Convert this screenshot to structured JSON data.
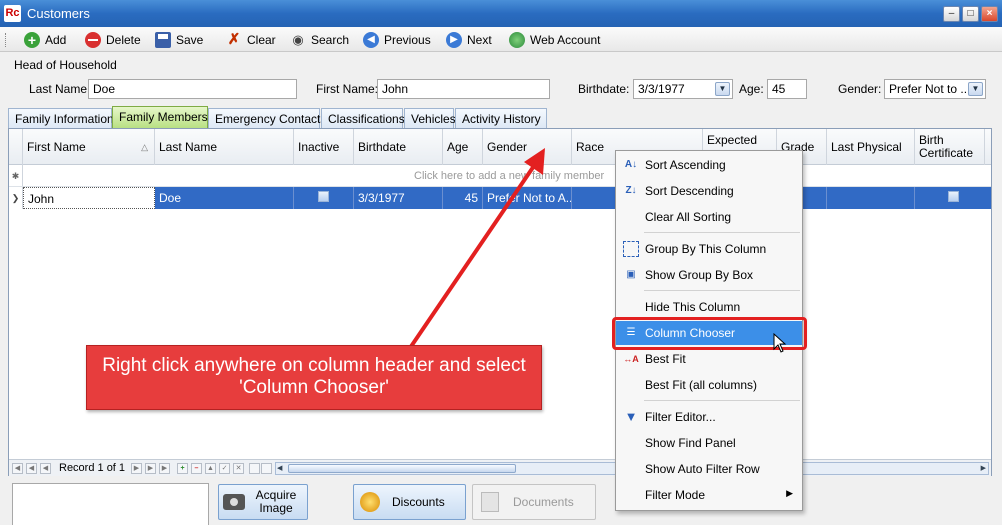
{
  "window": {
    "title": "Customers",
    "app_icon": "Rc"
  },
  "toolbar": {
    "add": "Add",
    "delete": "Delete",
    "save": "Save",
    "clear": "Clear",
    "search": "Search",
    "previous": "Previous",
    "next": "Next",
    "web_account": "Web Account"
  },
  "head_of_household": {
    "section_label": "Head of Household",
    "last_name_label": "Last Name:",
    "last_name": "Doe",
    "first_name_label": "First Name:",
    "first_name": "John",
    "birthdate_label": "Birthdate:",
    "birthdate": "3/3/1977",
    "age_label": "Age:",
    "age": "45",
    "gender_label": "Gender:",
    "gender": "Prefer Not to ..."
  },
  "tabs": [
    "Family Information",
    "Family Members",
    "Emergency Contacts",
    "Classifications",
    "Vehicles",
    "Activity History"
  ],
  "active_tab": "Family Members",
  "grid": {
    "columns": [
      "First Name",
      "Last Name",
      "Inactive",
      "Birthdate",
      "Age",
      "Gender",
      "Race",
      "Expected",
      "Grade",
      "Last Physical",
      "Birth Certificate"
    ],
    "new_row_prompt": "Click here to add a new family member",
    "rows": [
      {
        "first_name": "John",
        "last_name": "Doe",
        "birthdate": "3/3/1977",
        "age": "45",
        "gender": "Prefer Not to A..."
      }
    ]
  },
  "navigator": {
    "record_text": "Record 1 of 1"
  },
  "bottom": {
    "acquire_image": "Acquire Image",
    "discounts": "Discounts",
    "documents": "Documents"
  },
  "context_menu": {
    "sort_ascending": "Sort Ascending",
    "sort_descending": "Sort Descending",
    "clear_all_sorting": "Clear All Sorting",
    "group_by_column": "Group By This Column",
    "show_group_by_box": "Show Group By Box",
    "hide_column": "Hide This Column",
    "column_chooser": "Column Chooser",
    "best_fit": "Best Fit",
    "best_fit_all": "Best Fit (all columns)",
    "filter_editor": "Filter Editor...",
    "show_find_panel": "Show Find Panel",
    "show_auto_filter_row": "Show Auto Filter Row",
    "filter_mode": "Filter Mode"
  },
  "callout": {
    "text": "Right click anywhere on column header and select 'Column Chooser'"
  },
  "colors": {
    "accent": "#316ac5",
    "callout_red": "#e73d3d",
    "menu_highlight": "#3c8fe8"
  }
}
